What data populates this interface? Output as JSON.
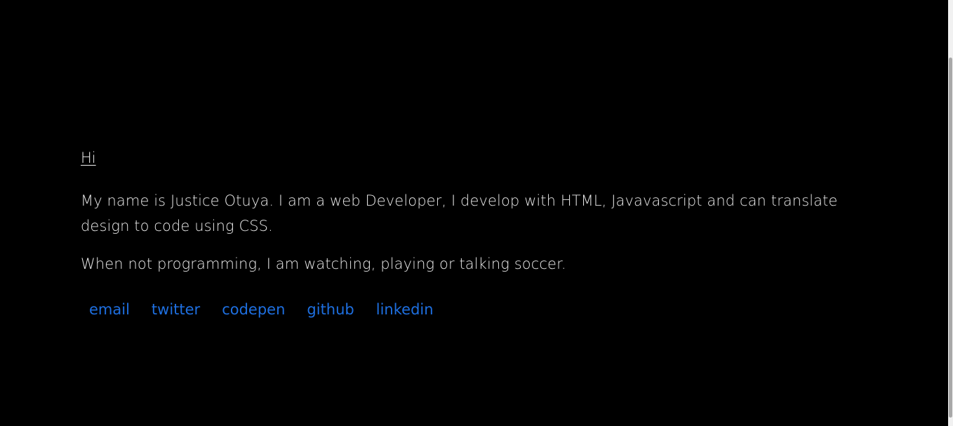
{
  "intro": {
    "greeting": "Hi",
    "paragraph_1": "My name is Justice Otuya. I am a web Developer, I develop with HTML, Javavascript and can translate design to code using CSS.",
    "paragraph_2": "When not programming, I am watching, playing or talking soccer."
  },
  "links": [
    {
      "label": "email"
    },
    {
      "label": "twitter"
    },
    {
      "label": "codepen"
    },
    {
      "label": "github"
    },
    {
      "label": "linkedin"
    }
  ],
  "colors": {
    "background": "#000000",
    "text": "#e6e6e6",
    "link": "#1e6fe0"
  }
}
